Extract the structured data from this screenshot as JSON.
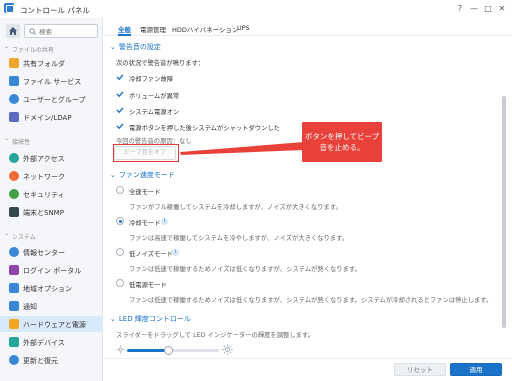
{
  "window": {
    "title": "コントロール パネル",
    "controls": [
      "?",
      "—",
      "□",
      "✕"
    ]
  },
  "search": {
    "placeholder": "検索"
  },
  "sidebar": {
    "groups": [
      {
        "header": "ファイルの共有",
        "items": [
          {
            "label": "共有フォルダ",
            "icon": "folder-icon",
            "color": "#f0a72c"
          },
          {
            "label": "ファイル サービス",
            "icon": "file-services-icon",
            "color": "#3a87d6"
          },
          {
            "label": "ユーザーとグループ",
            "icon": "users-icon",
            "color": "#3a87d6"
          },
          {
            "label": "ドメイン/LDAP",
            "icon": "domain-icon",
            "color": "#5c6bc0"
          }
        ]
      },
      {
        "header": "接続性",
        "items": [
          {
            "label": "外部アクセス",
            "icon": "external-access-icon",
            "color": "#26a69a"
          },
          {
            "label": "ネットワーク",
            "icon": "network-icon",
            "color": "#ef6c35"
          },
          {
            "label": "セキュリティ",
            "icon": "shield-icon",
            "color": "#43a047"
          },
          {
            "label": "端末とSNMP",
            "icon": "terminal-icon",
            "color": "#37474f"
          }
        ]
      },
      {
        "header": "システム",
        "items": [
          {
            "label": "情報センター",
            "icon": "info-icon",
            "color": "#3a87d6"
          },
          {
            "label": "ログイン ポータル",
            "icon": "login-portal-icon",
            "color": "#8e44ad"
          },
          {
            "label": "地域オプション",
            "icon": "regional-icon",
            "color": "#3a87d6"
          },
          {
            "label": "通知",
            "icon": "notification-icon",
            "color": "#3a87d6"
          },
          {
            "label": "ハードウェアと電源",
            "icon": "hardware-power-icon",
            "color": "#f5a623",
            "active": true
          },
          {
            "label": "外部デバイス",
            "icon": "external-device-icon",
            "color": "#26a69a"
          },
          {
            "label": "更新と復元",
            "icon": "update-restore-icon",
            "color": "#3a87d6"
          }
        ]
      }
    ]
  },
  "tabs": [
    {
      "label": "全般",
      "active": true
    },
    {
      "label": "電源管理",
      "active": false
    },
    {
      "label": "HDDハイバネーション",
      "active": false
    },
    {
      "label": "UPS",
      "active": false
    }
  ],
  "beep": {
    "section_title": "警告音の設定",
    "intro": "次の状況で警告音が鳴ります：",
    "options": [
      {
        "label": "冷却ファン故障",
        "checked": true
      },
      {
        "label": "ボリュームが異常",
        "checked": true
      },
      {
        "label": "システム電源オン",
        "checked": true
      },
      {
        "label": "電源ボタンを押した後システムがシャットダウンした",
        "checked": true
      }
    ],
    "current_reason": "今回の警告音の原因：なし",
    "button_label": "ビープ音をオフ"
  },
  "callout": {
    "text": "ボタンを押してビープ音を止める。",
    "color": "#e8413a"
  },
  "fan": {
    "section_title": "ファン速度モード",
    "modes": [
      {
        "label": "全速モード",
        "desc": "ファンがフル稼働してシステムを冷却しますが、ノイズが大きくなります。",
        "selected": false,
        "info": false
      },
      {
        "label": "冷却モード",
        "desc": "ファンは高速で稼働してシステムを冷やしますが、ノイズが大きくなります。",
        "selected": true,
        "info": true
      },
      {
        "label": "低ノイズモード",
        "desc": "ファンは低速で稼働するためノイズは低くなりますが、システムが熱くなります。",
        "selected": false,
        "info": true
      },
      {
        "label": "低電源モード",
        "desc": "ファンは低速で稼働するためノイズは低くなりますが、システムが熱くなります。システムが冷却されるとファンは停止します。",
        "selected": false,
        "info": false
      }
    ]
  },
  "led": {
    "section_title": "LED 輝度コントロール",
    "desc": "スライダーをドラッグして LED インジケーターの輝度を調整します。",
    "level": 0.45
  },
  "footer": {
    "reset_label": "リセット",
    "apply_label": "適用"
  },
  "colors": {
    "accent": "#1a73c9",
    "active_bg": "#d7e9fb",
    "callout": "#e8413a"
  }
}
